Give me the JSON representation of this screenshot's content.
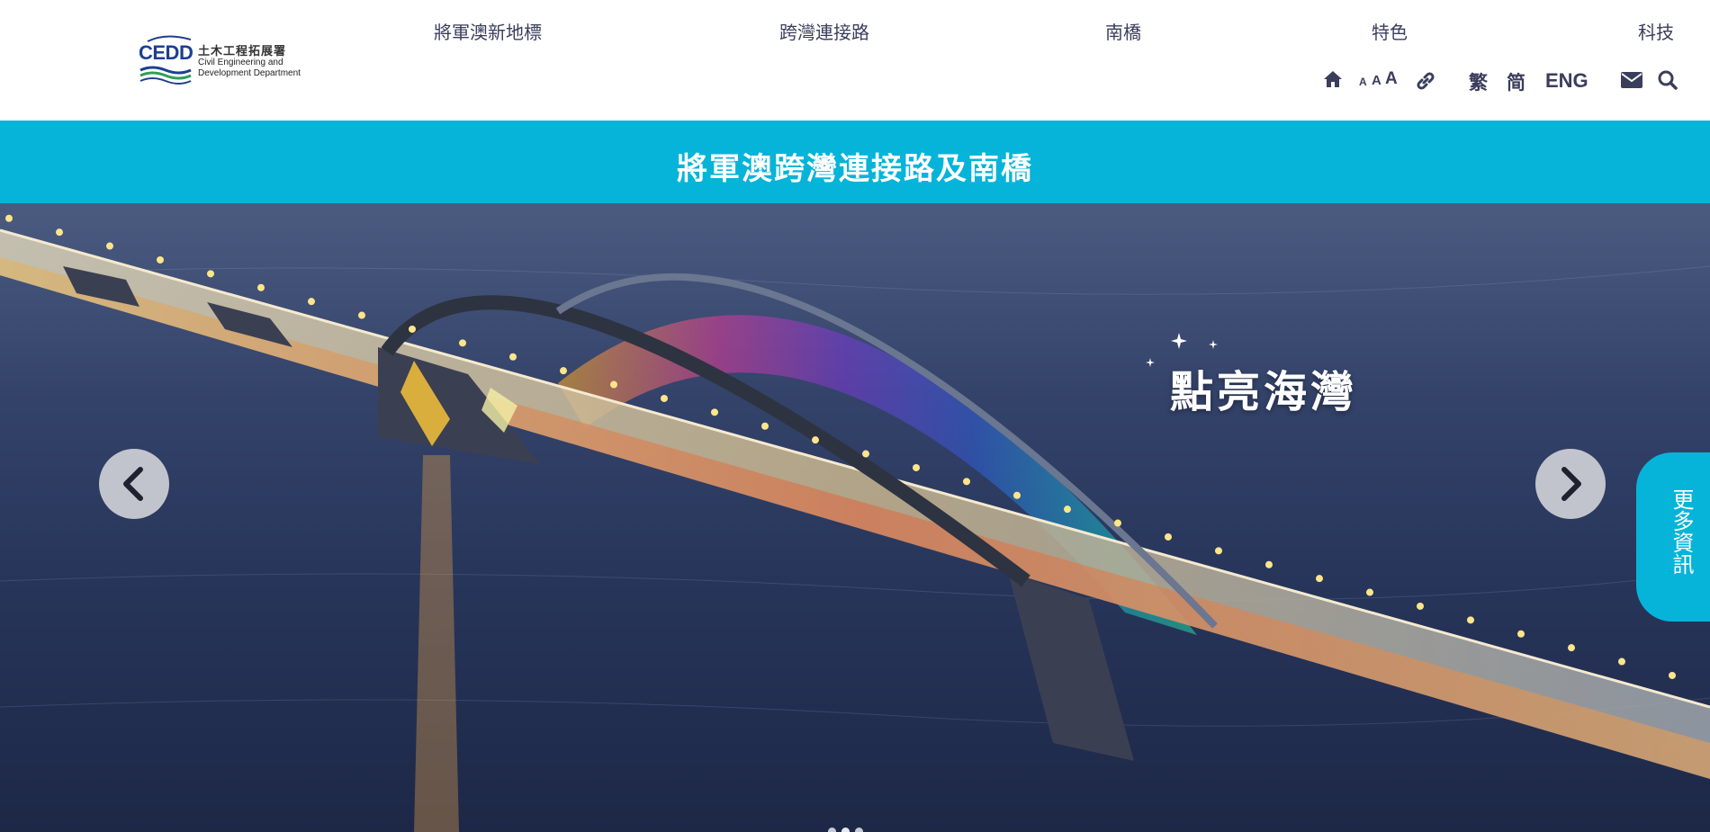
{
  "logo": {
    "abbr": "CEDD",
    "name_zh": "土木工程拓展署",
    "name_en_line1": "Civil Engineering and",
    "name_en_line2": "Development Department"
  },
  "nav": [
    {
      "label": "將軍澳新地標"
    },
    {
      "label": "跨灣連接路"
    },
    {
      "label": "南橋"
    },
    {
      "label": "特色"
    },
    {
      "label": "科技"
    }
  ],
  "tools": {
    "home_icon": "home-icon",
    "font_small": "A",
    "font_medium": "A",
    "font_large": "A",
    "link_icon": "link-icon",
    "lang_trad": "繁",
    "lang_simp": "简",
    "lang_eng": "ENG",
    "mail_icon": "mail-icon",
    "search_icon": "search-icon"
  },
  "title": "將軍澳跨灣連接路及南橋",
  "hero": {
    "caption": "點亮海灣",
    "prev_icon": "chevron-left-icon",
    "next_icon": "chevron-right-icon",
    "more_info": "更多資訊",
    "slide_count": 3,
    "active_slide": 2
  },
  "colors": {
    "accent": "#06b4d9",
    "nav_text": "#3a3e5c",
    "water": "#27355a"
  }
}
